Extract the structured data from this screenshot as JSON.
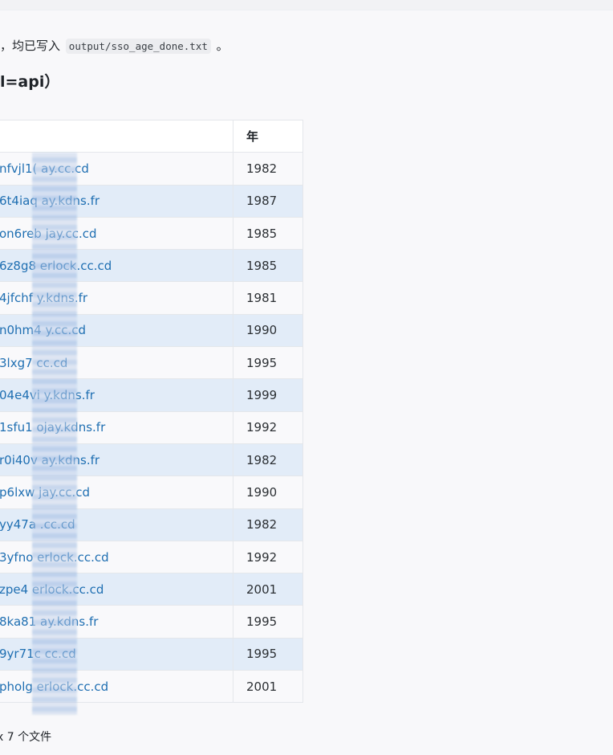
{
  "line1": {
    "prefix": "，均已写入",
    "code": "output/sso_age_done.txt",
    "suffix": "。"
  },
  "heading": "l=api）",
  "table": {
    "headers": [
      "",
      "年"
    ],
    "rows": [
      {
        "host": "nfvjl1(  ay.cc.cd",
        "year": "1982"
      },
      {
        "host": "6t4iaq  ay.kdns.fr",
        "year": "1987"
      },
      {
        "host": "on6reb  jay.cc.cd",
        "year": "1985"
      },
      {
        "host": "6z8g8  erlock.cc.cd",
        "year": "1985"
      },
      {
        "host": "4jfchf  y.kdns.fr",
        "year": "1981"
      },
      {
        "host": "n0hm4  y.cc.cd",
        "year": "1990"
      },
      {
        "host": "3lxg7  cc.cd",
        "year": "1995"
      },
      {
        "host": "04e4vi  y.kdns.fr",
        "year": "1999"
      },
      {
        "host": "1sfu1  ojay.kdns.fr",
        "year": "1992"
      },
      {
        "host": "r0i40v  ay.kdns.fr",
        "year": "1982"
      },
      {
        "host": "p6lxw  jay.cc.cd",
        "year": "1990"
      },
      {
        "host": "yy47a  .cc.cd",
        "year": "1982"
      },
      {
        "host": "3yfno  erlock.cc.cd",
        "year": "1992"
      },
      {
        "host": "zpe4  erlock.cc.cd",
        "year": "2001"
      },
      {
        "host": "8ka81  ay.kdns.fr",
        "year": "1995"
      },
      {
        "host": "9yr71c  cc.cd",
        "year": "1995"
      },
      {
        "host": "pholg  erlock.cc.cd",
        "year": "2001"
      }
    ]
  },
  "footer": "x 7 个文件"
}
